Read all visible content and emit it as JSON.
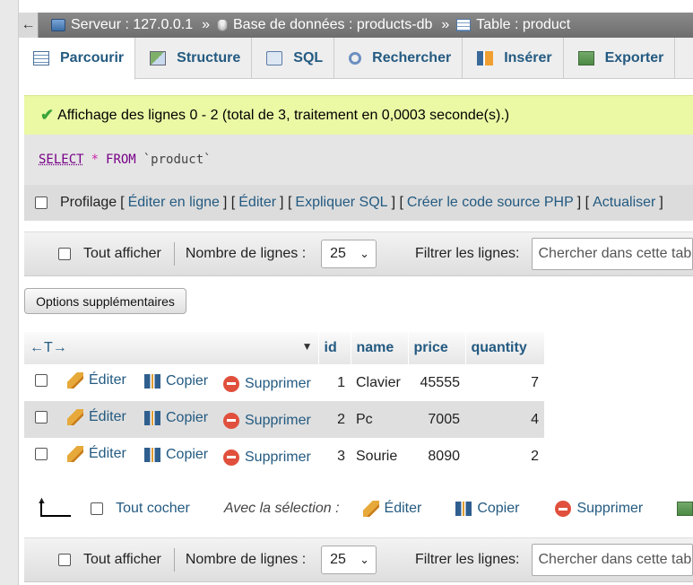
{
  "breadcrumb": {
    "back": "←",
    "server": "Serveur : 127.0.0.1",
    "sep": "»",
    "database": "Base de données : products-db",
    "table": "Table : product"
  },
  "tabs": [
    "Parcourir",
    "Structure",
    "SQL",
    "Rechercher",
    "Insérer",
    "Exporter"
  ],
  "message": "Affichage des lignes 0 - 2 (total de 3, traitement en 0,0003 seconde(s).)",
  "sql": {
    "select": "SELECT",
    "star": "*",
    "from": "FROM",
    "table": "`product`"
  },
  "sql_links": {
    "profiling": "Profilage",
    "open": "[",
    "close": "]",
    "divider": "] [",
    "edit_inline": "Éditer en ligne",
    "edit": "Éditer",
    "explain": "Expliquer SQL",
    "php": "Créer le code source PHP",
    "refresh": "Actualiser"
  },
  "nav": {
    "show_all": "Tout afficher",
    "rows_label": "Nombre de lignes :",
    "rows_value": "25",
    "filter_label": "Filtrer les lignes:",
    "filter_placeholder": "Chercher dans cette table"
  },
  "options_button": "Options supplémentaires",
  "table": {
    "arrows": "←T→",
    "sort_indicator": "▼",
    "columns": [
      "id",
      "name",
      "price",
      "quantity"
    ],
    "actions": {
      "edit": "Éditer",
      "copy": "Copier",
      "delete": "Supprimer"
    },
    "rows": [
      {
        "id": "1",
        "name": "Clavier",
        "price": "45555",
        "quantity": "7"
      },
      {
        "id": "2",
        "name": "Pc",
        "price": "7005",
        "quantity": "4"
      },
      {
        "id": "3",
        "name": "Sourie",
        "price": "8090",
        "quantity": "2"
      }
    ]
  },
  "bulk": {
    "check_all": "Tout cocher",
    "with_selection": "Avec la sélection :",
    "edit": "Éditer",
    "copy": "Copier",
    "delete": "Supprimer"
  }
}
